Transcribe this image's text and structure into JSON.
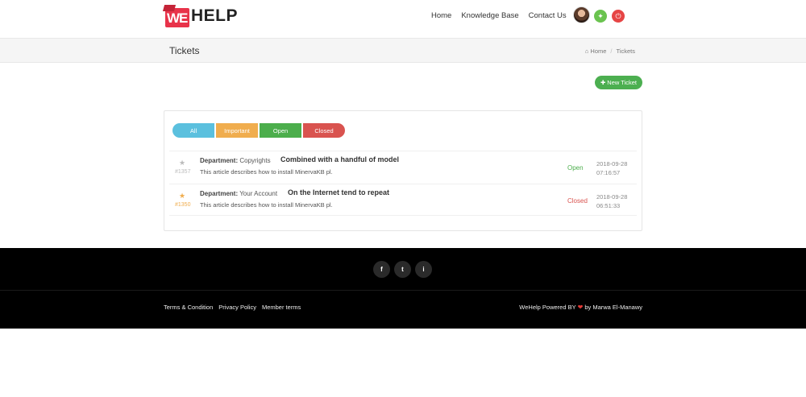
{
  "brand": {
    "logo_we": "WE",
    "logo_help": "HELP"
  },
  "nav": {
    "items": [
      "Home",
      "Knowledge Base",
      "Contact Us"
    ]
  },
  "page": {
    "title": "Tickets"
  },
  "breadcrumb": {
    "home": "Home",
    "current": "Tickets"
  },
  "actions": {
    "new_ticket": "New Ticket"
  },
  "filters": {
    "all": "All",
    "important": "Important",
    "open": "Open",
    "closed": "Closed"
  },
  "tickets": [
    {
      "id": "#1357",
      "department_label": "Department:",
      "department": "Copyrights",
      "subject": "Combined with a handful of model",
      "description": "This article describes how to install MinervaKB pl.",
      "status": "Open",
      "date": "2018-09-28",
      "time": "07:16:57"
    },
    {
      "id": "#1350",
      "department_label": "Department:",
      "department": "Your Account",
      "subject": "On the Internet tend to repeat",
      "description": "This article describes how to install MinervaKB pl.",
      "status": "Closed",
      "date": "2018-09-28",
      "time": "06:51:33"
    }
  ],
  "footer": {
    "social": [
      "f",
      "t",
      "i"
    ],
    "links": [
      "Terms & Condition",
      "Privacy Policy",
      "Member terms"
    ],
    "credit_before": "WeHelp Powered BY",
    "credit_after": "by Marwa El-Manawy"
  },
  "colors": {
    "brand": "#e8334a",
    "all": "#5bc0de",
    "important": "#f0ad4e",
    "open": "#4cae4c",
    "closed": "#d9534f",
    "new_ticket": "#4caf50"
  }
}
